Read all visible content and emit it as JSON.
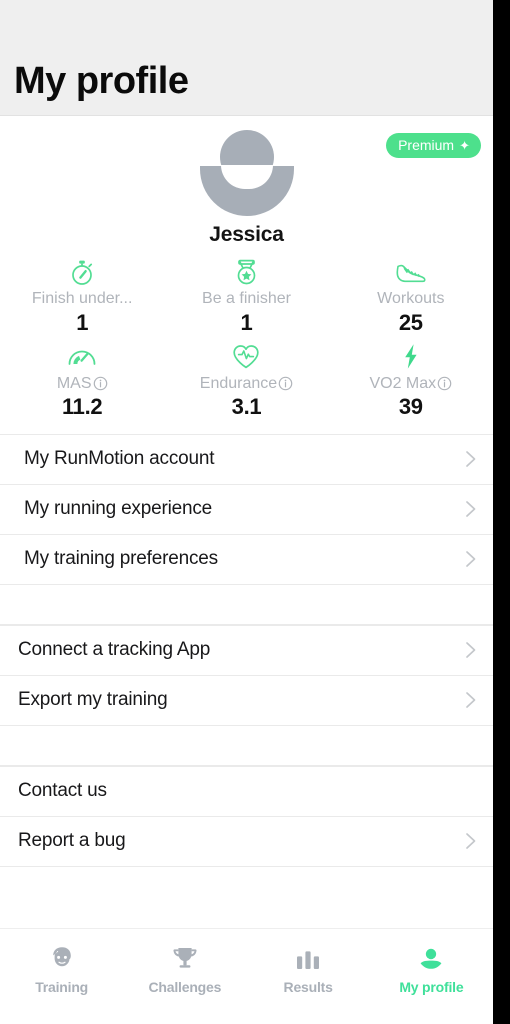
{
  "header": {
    "title": "My profile"
  },
  "colors": {
    "accent_green": "#4de08c",
    "active_tab_green": "#3fe09a",
    "header_bg": "#efefef",
    "muted_gray": "#b0b4ba",
    "avatar_gray": "#a7aeb7"
  },
  "premium": {
    "label": "Premium",
    "spark": "✦"
  },
  "profile": {
    "name": "Jessica",
    "avatar_icon": "person-avatar-icon"
  },
  "stats": [
    {
      "icon": "stopwatch-icon",
      "label": "Finish under...",
      "value": "1",
      "has_info": false
    },
    {
      "icon": "medal-icon",
      "label": "Be a finisher",
      "value": "1",
      "has_info": false
    },
    {
      "icon": "running-shoe-icon",
      "label": "Workouts",
      "value": "25",
      "has_info": false
    },
    {
      "icon": "speedometer-icon",
      "label": "MAS",
      "value": "11.2",
      "has_info": true
    },
    {
      "icon": "heart-pulse-icon",
      "label": "Endurance",
      "value": "3.1",
      "has_info": true
    },
    {
      "icon": "lightning-bolt-icon",
      "label": "VO2 Max",
      "value": "39",
      "has_info": true
    }
  ],
  "menu_groups": [
    {
      "rows": [
        {
          "label": "My RunMotion account",
          "chevron": true
        },
        {
          "label": "My running experience",
          "chevron": true
        },
        {
          "label": "My training preferences",
          "chevron": true
        }
      ]
    },
    {
      "rows": [
        {
          "label": "Connect a tracking App",
          "chevron": true
        },
        {
          "label": "Export my training",
          "chevron": true
        }
      ]
    },
    {
      "rows": [
        {
          "label": "Contact us",
          "chevron": false
        },
        {
          "label": "Report a bug",
          "chevron": true
        }
      ]
    }
  ],
  "tabs": [
    {
      "label": "Training",
      "icon": "coach-face-icon",
      "active": false
    },
    {
      "label": "Challenges",
      "icon": "trophy-icon",
      "active": false
    },
    {
      "label": "Results",
      "icon": "bar-chart-icon",
      "active": false
    },
    {
      "label": "My profile",
      "icon": "person-icon",
      "active": true
    }
  ]
}
